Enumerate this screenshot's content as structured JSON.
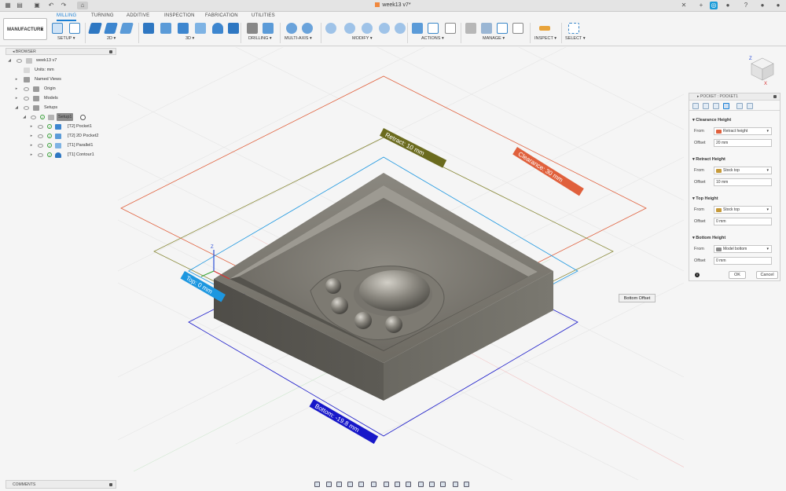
{
  "window": {
    "document_title": "week13 v7*"
  },
  "workspace": {
    "label": "MANUFACTURE"
  },
  "tabs": [
    "MILLING",
    "TURNING",
    "ADDITIVE",
    "INSPECTION",
    "FABRICATION",
    "UTILITIES"
  ],
  "active_tab": "MILLING",
  "toolbar_groups": {
    "setup": "SETUP",
    "two_d": "2D",
    "three_d": "3D",
    "drilling": "DRILLING",
    "multi_axis": "MULTI-AXIS",
    "modify": "MODIFY",
    "actions": "ACTIONS",
    "manage": "MANAGE",
    "inspect": "INSPECT",
    "select": "SELECT"
  },
  "browser": {
    "title": "BROWSER",
    "items": [
      {
        "label": "week13 v7",
        "level": 0
      },
      {
        "label": "Units: mm",
        "level": 1
      },
      {
        "label": "Named Views",
        "level": 1
      },
      {
        "label": "Origin",
        "level": 1
      },
      {
        "label": "Models",
        "level": 1
      },
      {
        "label": "Setups",
        "level": 1
      },
      {
        "label": "Setup1",
        "level": 2
      },
      {
        "label": "[T2] Pocket1",
        "level": 3
      },
      {
        "label": "[T2] 2D Pocket2",
        "level": 3
      },
      {
        "label": "[T1] Parallel1",
        "level": 3
      },
      {
        "label": "[T1] Contour1",
        "level": 3
      }
    ]
  },
  "comments": {
    "title": "COMMENTS"
  },
  "viewport_labels": {
    "retract": "Retract: 10 mm",
    "clearance": "Clearance: 30 mm",
    "top": "Top: 0 mm",
    "bottom": "Bottom: -19.8 mm"
  },
  "viewcube": {
    "z": "Z",
    "x": "X"
  },
  "panel": {
    "title": "POCKET : POCKET1",
    "sections": [
      {
        "heading": "Clearance Height",
        "from_label": "From",
        "from_value": "Retract height",
        "offset_label": "Offset",
        "offset_value": "20 mm"
      },
      {
        "heading": "Retract Height",
        "from_label": "From",
        "from_value": "Stock top",
        "offset_label": "Offset",
        "offset_value": "10 mm"
      },
      {
        "heading": "Top Height",
        "from_label": "From",
        "from_value": "Stock top",
        "offset_label": "Offset",
        "offset_value": "0 mm"
      },
      {
        "heading": "Bottom Height",
        "from_label": "From",
        "from_value": "Model bottom",
        "offset_label": "Offset",
        "offset_value": "0 mm"
      }
    ],
    "ok": "OK",
    "cancel": "Cancel"
  },
  "tooltip": "Bottom Offset",
  "colors": {
    "accent": "#1a7fd4",
    "clearance": "#e0603c",
    "retract": "#6b6b1e",
    "top": "#1d97e0",
    "bottom": "#1717c9"
  }
}
